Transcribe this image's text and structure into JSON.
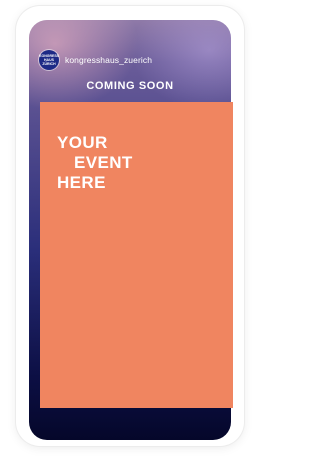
{
  "story": {
    "account": {
      "avatar_text": "KONGRESS HAUS ZÜRICH",
      "username": "kongresshaus_zuerich"
    },
    "title": "COMING SOON",
    "event_text": {
      "line1": "YOUR",
      "line2": "EVENT",
      "line3": "HERE"
    }
  },
  "colors": {
    "panel": "#f08560",
    "background_top": "#8f7aa8",
    "background_bottom": "#05072a",
    "avatar": "#1d2a86"
  }
}
